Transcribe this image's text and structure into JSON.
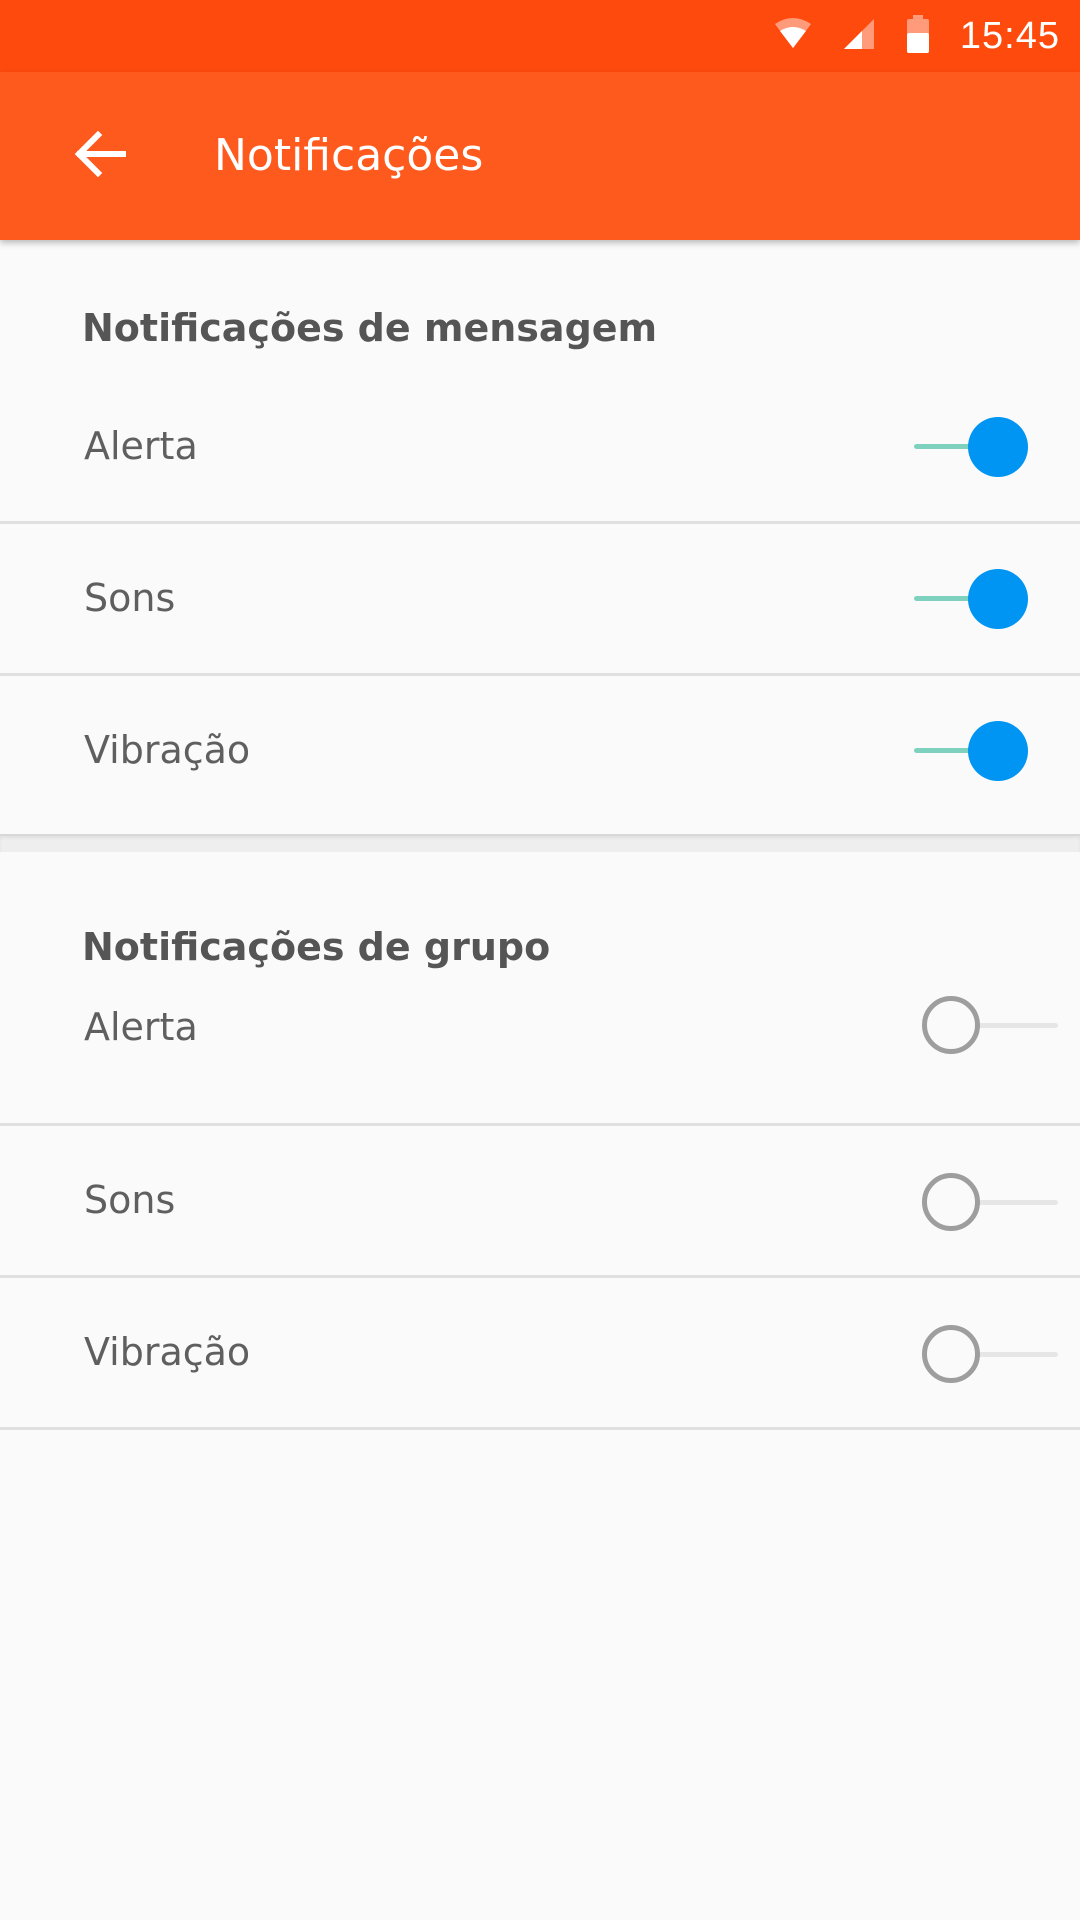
{
  "statusbar": {
    "time": "15:45",
    "icons": [
      "wifi-icon",
      "signal-icon",
      "battery-icon"
    ]
  },
  "appbar": {
    "title": "Notificações",
    "back_icon": "arrow-left-icon",
    "color": "#ff5a1e"
  },
  "sections": [
    {
      "header": "Notificações de mensagem",
      "items": [
        {
          "label": "Alerta",
          "enabled": true
        },
        {
          "label": "Sons",
          "enabled": true
        },
        {
          "label": "Vibração",
          "enabled": true
        }
      ]
    },
    {
      "header": "Notificações de grupo",
      "items": [
        {
          "label": "Alerta",
          "enabled": false
        },
        {
          "label": "Sons",
          "enabled": false
        },
        {
          "label": "Vibração",
          "enabled": false
        }
      ]
    }
  ],
  "colors": {
    "statusbar": "#ff4a0d",
    "toggle_on_thumb": "#0095f2",
    "toggle_on_track": "#7fd1bf",
    "toggle_off_ring": "#9e9e9e"
  }
}
